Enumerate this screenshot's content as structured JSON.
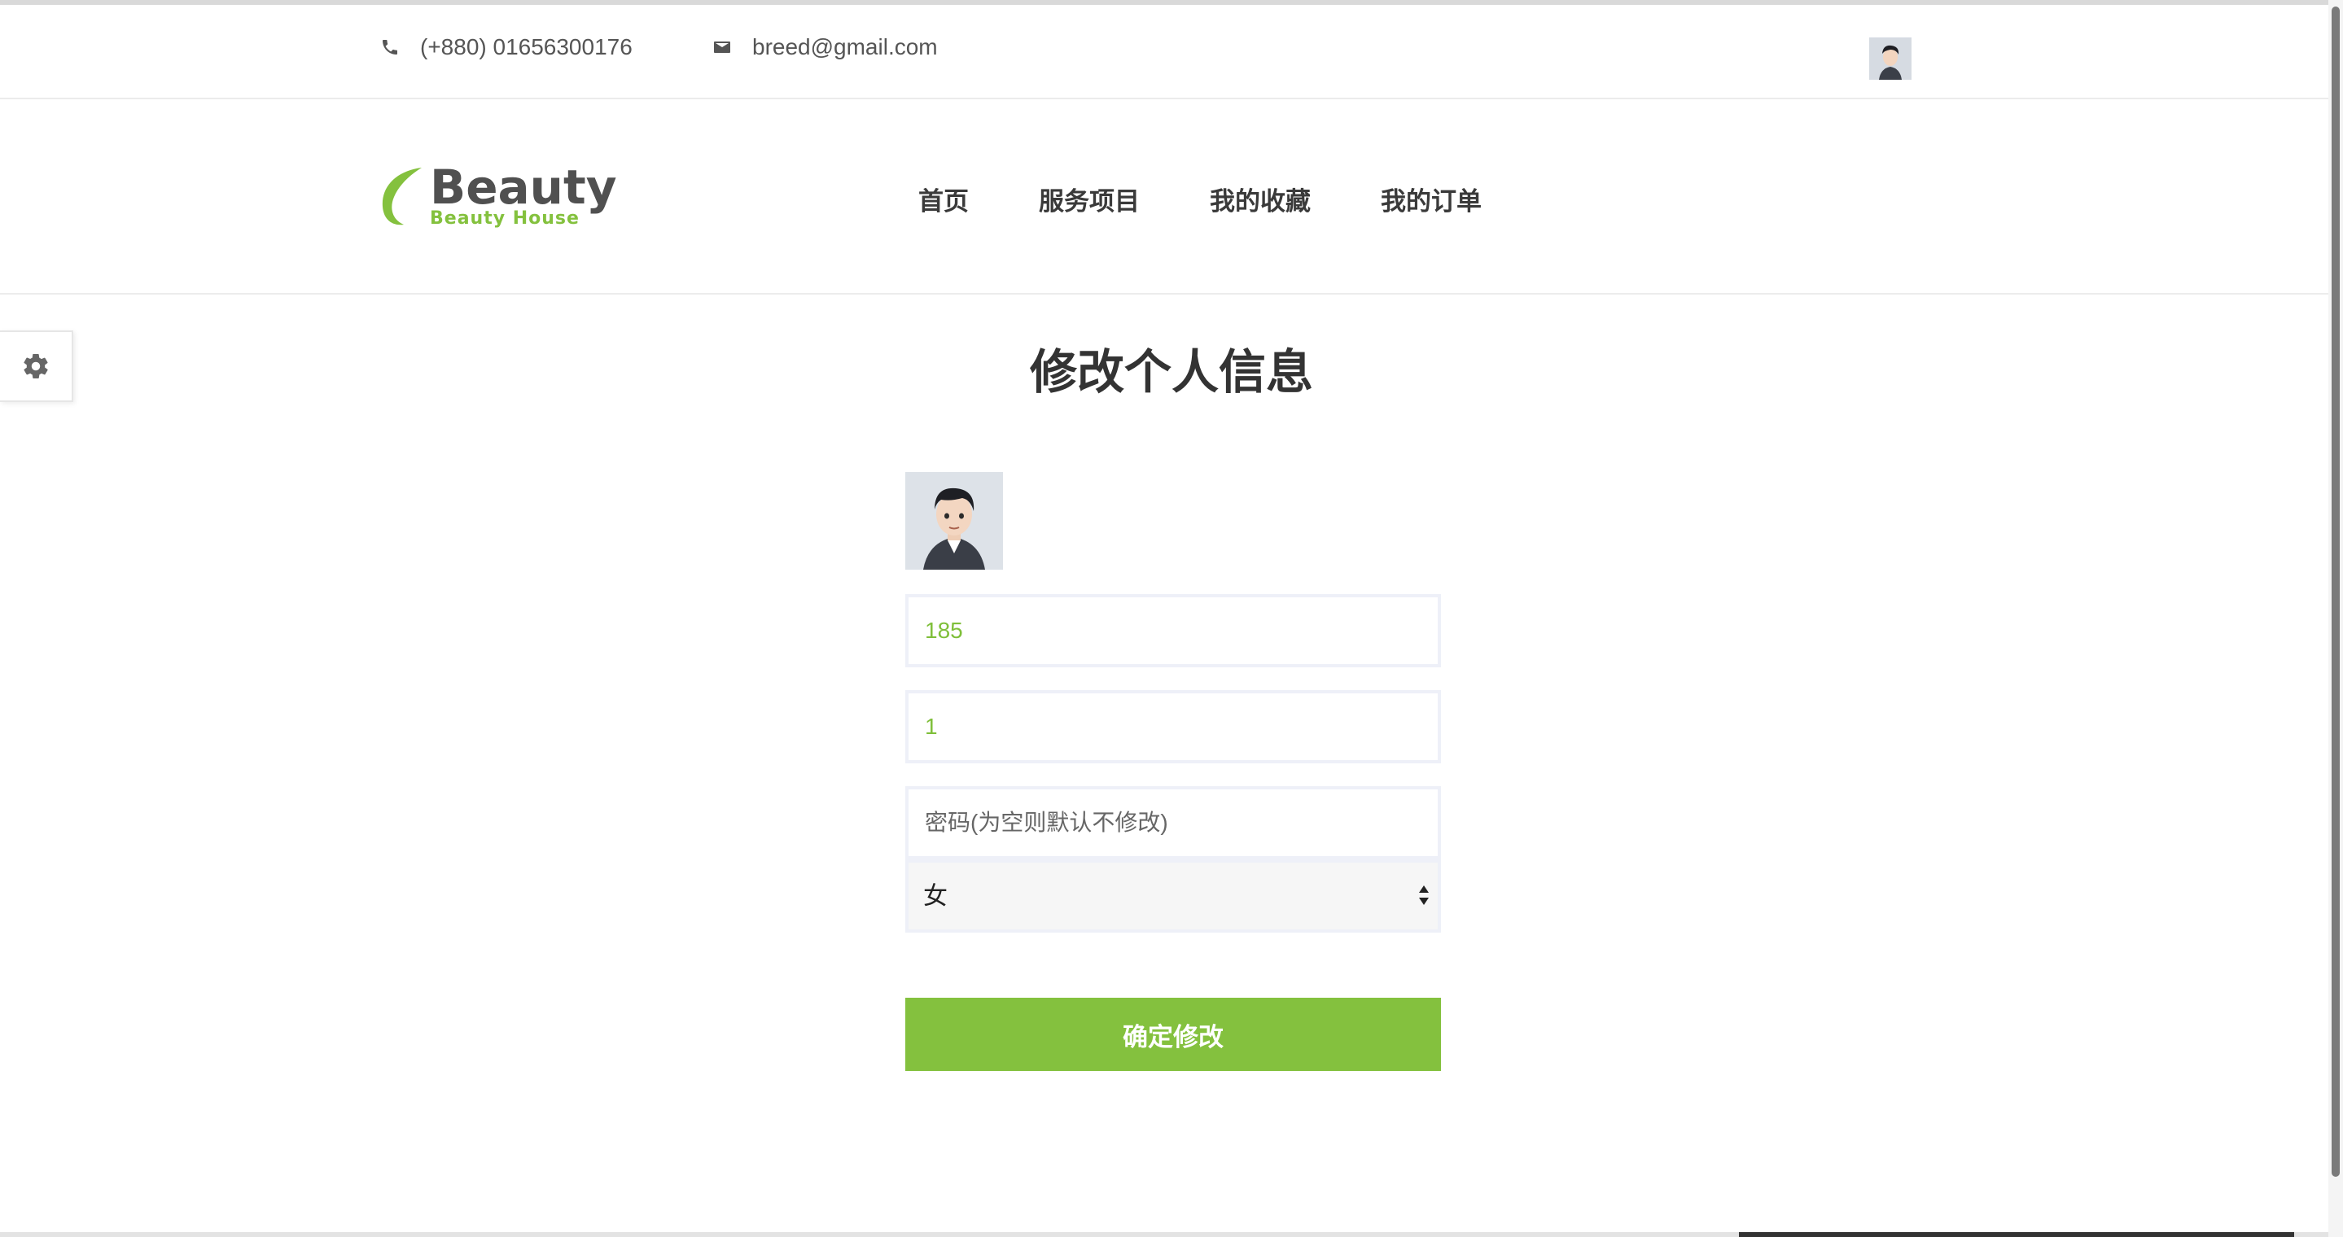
{
  "topbar": {
    "phone": "(+880) 01656300176",
    "email": "breed@gmail.com",
    "phone_icon": "phone-icon",
    "email_icon": "mail-icon"
  },
  "header": {
    "logo_main": "Beauty",
    "logo_sub": "Beauty House",
    "nav": [
      {
        "label": "首页"
      },
      {
        "label": "服务项目"
      },
      {
        "label": "我的收藏"
      },
      {
        "label": "我的订单"
      }
    ]
  },
  "settings": {
    "icon": "gear-icon"
  },
  "page_title": "修改个人信息",
  "form": {
    "field1_value": "185",
    "field2_value": "1",
    "password_placeholder": "密码(为空则默认不修改)",
    "gender_selected": "女",
    "submit_label": "确定修改"
  },
  "colors": {
    "accent": "#84c13e",
    "text_dark": "#333333"
  }
}
